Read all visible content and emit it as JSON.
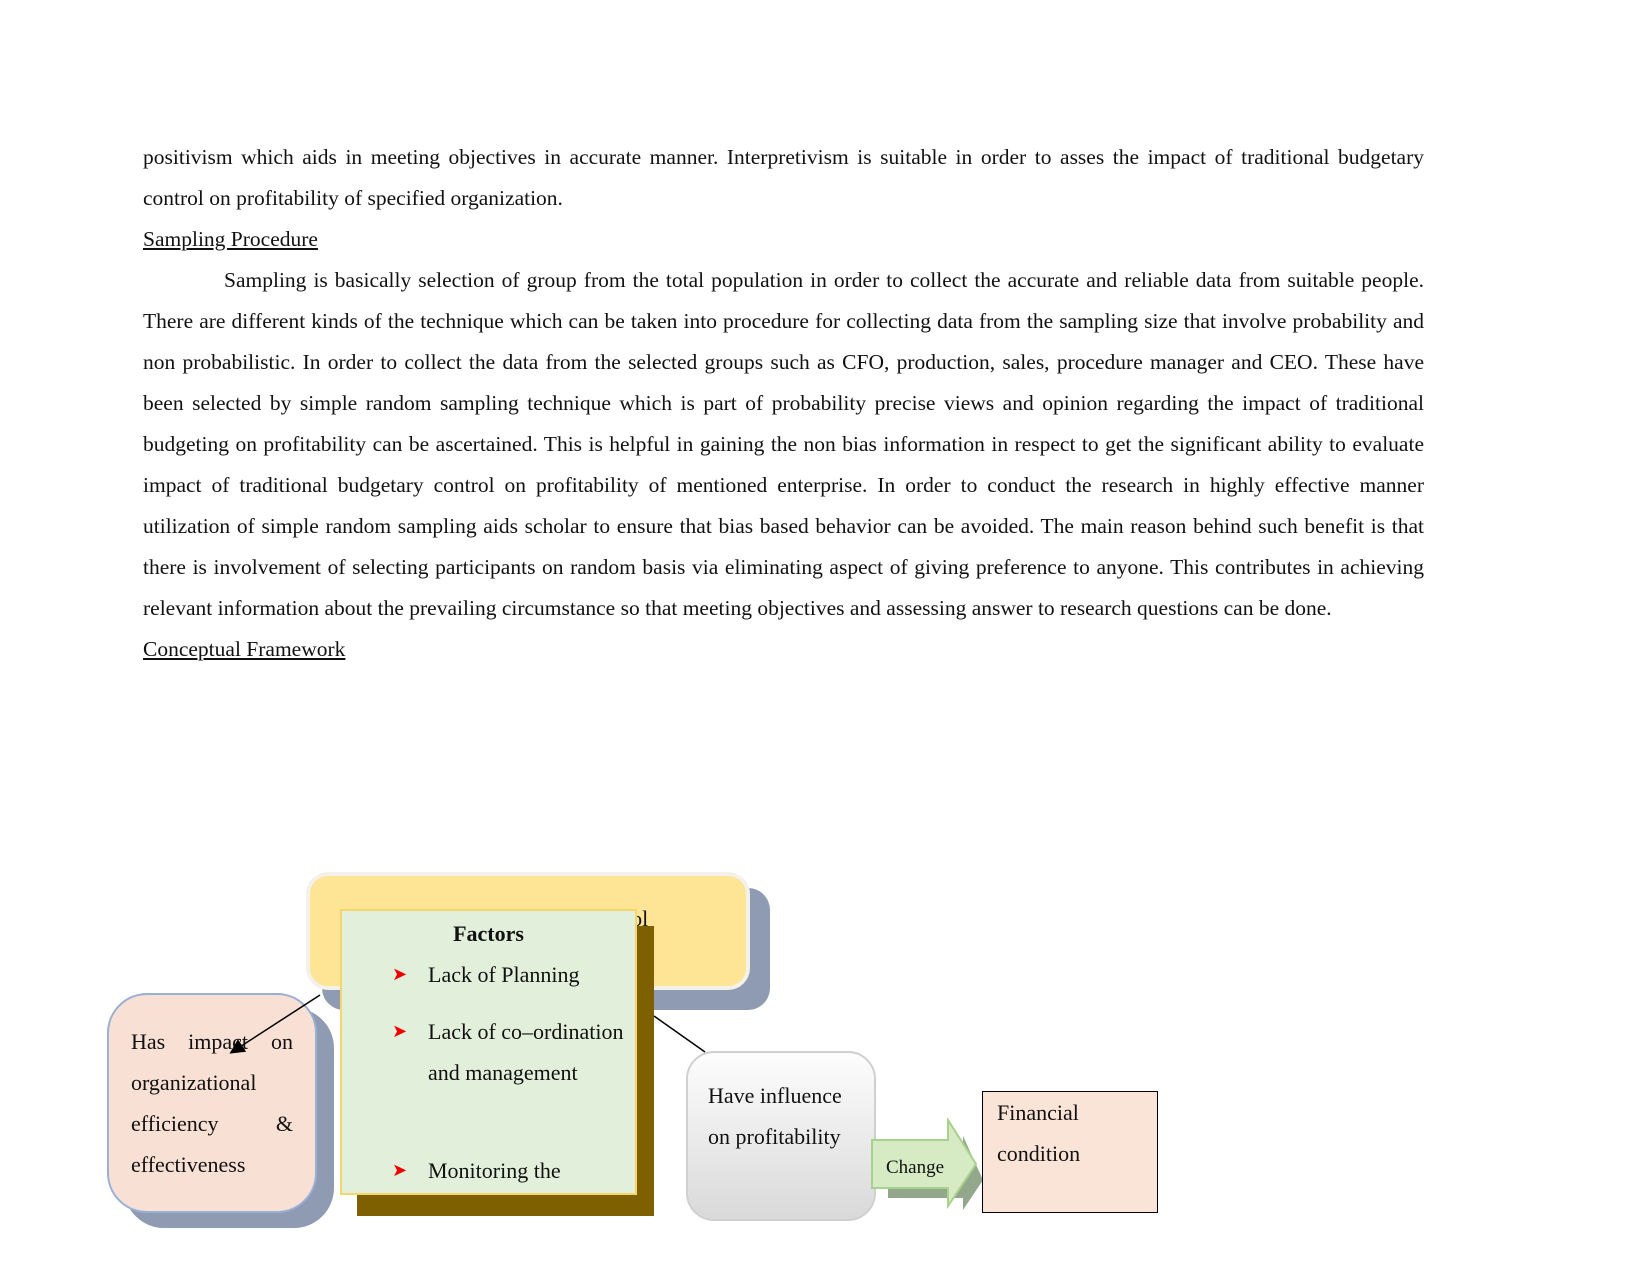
{
  "paragraphs": {
    "intro_continued": "positivism which aids in meeting objectives in accurate manner. Interpretivism is suitable in order to asses the impact of traditional budgetary control on profitability of specified organization.",
    "sampling_heading": "Sampling Procedure",
    "sampling_body": "Sampling is basically selection of group from the total population in order to collect the accurate and reliable data from suitable people. There are different kinds of the technique which can be taken into procedure for collecting data from the sampling size that involve probability and non probabilistic. In order to collect the data from the selected groups such as CFO, production, sales, procedure manager and CEO. These have been selected by simple random sampling technique which is part of probability precise views and opinion regarding the impact of traditional budgeting on profitability can be ascertained. This  is helpful in gaining the non bias information in respect to get the significant ability to evaluate impact of traditional budgetary control on profitability of mentioned enterprise. In order to conduct the research in highly effective manner utilization of simple random sampling aids scholar to ensure that bias based behavior can be avoided.  The main reason behind such benefit is that there is involvement of selecting participants on random basis via eliminating aspect of giving preference to anyone. This contributes in achieving relevant information about the prevailing circumstance so that meeting objectives and assessing answer to research  questions can be done.",
    "framework_heading": "Conceptual Framework"
  },
  "diagram": {
    "top_box": "Traditional budgetary control",
    "factors_title": "Factors",
    "factors": [
      "Lack of Planning",
      "Lack of co–ordination and management",
      "Monitoring the"
    ],
    "left_box": "Has impact on organizational efficiency &amp; effectiveness",
    "left_box_text": "Has impact on organizational efficiency & effectiveness",
    "middle_box": "Have influence on profitability",
    "arrow_label": "Change",
    "right_box": "Financial condition",
    "colors": {
      "top_box": "#fde595",
      "factors_box": "#e2efda",
      "factors_shadow": "#7f6000",
      "left_box": "#f8e0d4",
      "right_box": "#fae3d7",
      "bullet": "#e00000",
      "arrow": "#d6ebc4"
    }
  }
}
